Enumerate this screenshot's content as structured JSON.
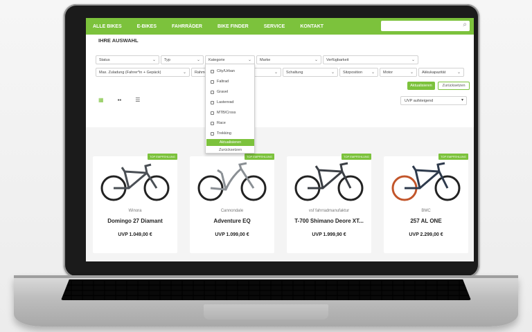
{
  "nav": {
    "items": [
      "ALLE BIKES",
      "E-BIKES",
      "FAHRRÄDER",
      "BIKE FINDER",
      "SERVICE",
      "KONTAKT"
    ],
    "search_icon": "search-icon"
  },
  "page_title": "IHRE AUSWAHL",
  "filters_row1": [
    "Status",
    "Typ",
    "Kategorie",
    "Marke",
    "Verfügbarkeit"
  ],
  "filters_row2": [
    "Max. Zuladung (Fahrer*in + Gepäck)",
    "Rahme",
    "Schaltung",
    "Sitzposition",
    "Motor",
    "Akkukapazität"
  ],
  "actions": {
    "apply": "Aktualisieren",
    "reset": "Zurücksetzen"
  },
  "sort": {
    "value": "UVP aufsteigend"
  },
  "dropdown": {
    "options": [
      "City/Urban",
      "Faltrad",
      "Gravel",
      "Lastenrad",
      "MTB/Cross",
      "Race",
      "Trekking"
    ],
    "apply": "Aktualisieren",
    "reset": "Zurücksetzen"
  },
  "badge_label": "TOP EMPFEHLUNG",
  "products": [
    {
      "brand": "Winora",
      "name": "Domingo 27 Diamant",
      "price": "UVP 1.049,00 €",
      "frame_color": "#4a4f55"
    },
    {
      "brand": "Cannondale",
      "name": "Adventure EQ",
      "price": "UVP 1.099,00 €",
      "frame_color": "#8a8f94"
    },
    {
      "brand": "vsf fahrradmanufaktur",
      "name": "T-700 Shimano Deore XT...",
      "price": "UVP 1.999,90 €",
      "frame_color": "#3b3f45"
    },
    {
      "brand": "BMC",
      "name": "257 AL ONE",
      "price": "UVP 2.299,00 €",
      "frame_color": "#2e3a4c"
    }
  ],
  "colors": {
    "accent": "#7cc23c"
  }
}
